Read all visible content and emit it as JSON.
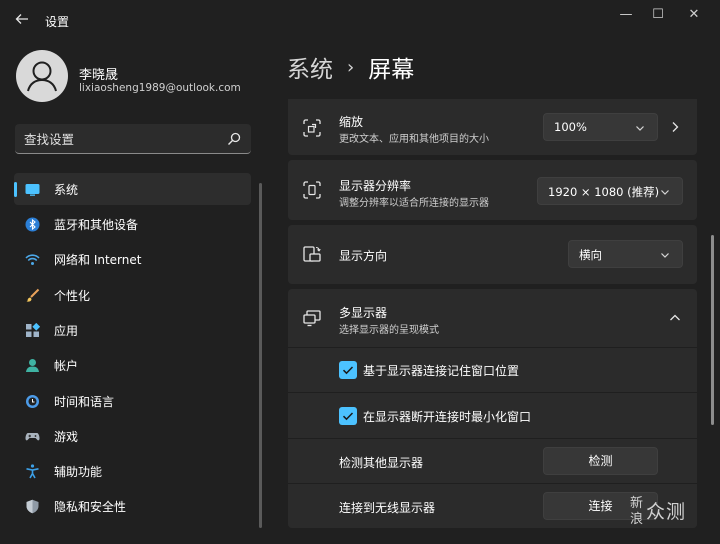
{
  "window": {
    "title": "设置",
    "controls": {
      "minimize": "—",
      "maximize": "☐",
      "close": "✕"
    }
  },
  "user": {
    "name": "李晓晟",
    "email": "lixiaosheng1989@outlook.com"
  },
  "search": {
    "placeholder": "查找设置"
  },
  "sidebar": {
    "items": [
      {
        "label": "系统",
        "icon": "monitor-icon",
        "active": true
      },
      {
        "label": "蓝牙和其他设备",
        "icon": "bluetooth-icon"
      },
      {
        "label": "网络和 Internet",
        "icon": "wifi-icon"
      },
      {
        "label": "个性化",
        "icon": "brush-icon"
      },
      {
        "label": "应用",
        "icon": "apps-icon"
      },
      {
        "label": "帐户",
        "icon": "person-icon"
      },
      {
        "label": "时间和语言",
        "icon": "clock-globe-icon"
      },
      {
        "label": "游戏",
        "icon": "gamepad-icon"
      },
      {
        "label": "辅助功能",
        "icon": "accessibility-icon"
      },
      {
        "label": "隐私和安全性",
        "icon": "shield-icon"
      }
    ]
  },
  "header": {
    "parent": "系统",
    "separator": "›",
    "current": "屏幕"
  },
  "settings": {
    "scale": {
      "title": "缩放",
      "subtitle": "更改文本、应用和其他项目的大小",
      "value": "100%"
    },
    "resolution": {
      "title": "显示器分辨率",
      "subtitle": "调整分辨率以适合所连接的显示器",
      "value": "1920 × 1080 (推荐)"
    },
    "orientation": {
      "title": "显示方向",
      "value": "横向"
    },
    "multi": {
      "title": "多显示器",
      "subtitle": "选择显示器的呈现模式",
      "remember_label": "基于显示器连接记住窗口位置",
      "minimize_label": "在显示器断开连接时最小化窗口",
      "detect_label": "检测其他显示器",
      "detect_button": "检测",
      "wireless_label": "连接到无线显示器",
      "wireless_button": "连接"
    }
  },
  "watermark": {
    "a": "新",
    "b": "浪",
    "c": "众测"
  },
  "colors": {
    "accent": "#4cc2ff",
    "background": "#202020",
    "card": "#2b2b2b"
  }
}
